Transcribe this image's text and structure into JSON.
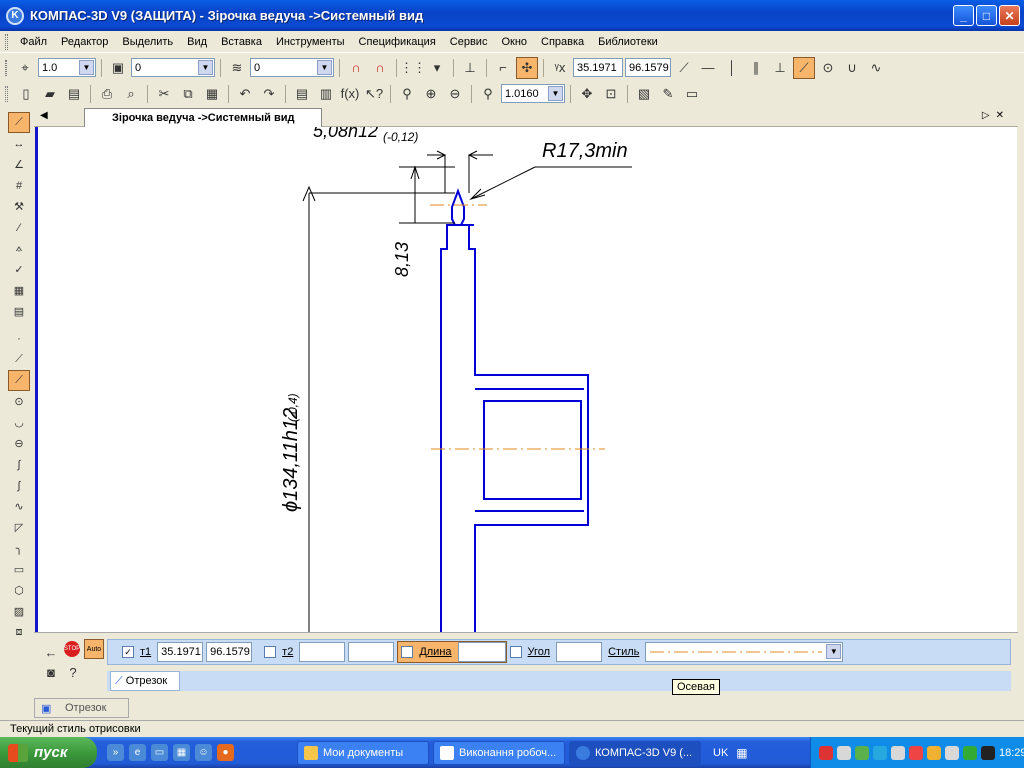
{
  "window": {
    "title": "КОМПАС-3D V9 (ЗАЩИТА) - Зірочка ведуча ->Системный вид"
  },
  "menu": [
    "Файл",
    "Редактор",
    "Выделить",
    "Вид",
    "Вставка",
    "Инструменты",
    "Спецификация",
    "Сервис",
    "Окно",
    "Справка",
    "Библиотеки"
  ],
  "toolbar1": {
    "step": "1.0",
    "layer1": "0",
    "layer2": "0",
    "coord_x": "35.1971",
    "coord_y": "96.1579"
  },
  "toolbar2": {
    "zoom": "1.0160"
  },
  "doc_tab": {
    "label": "Зірочка ведуча ->Системный вид"
  },
  "drawing": {
    "dim_top": "5,08h12",
    "dim_top_tol": "(-0,12)",
    "radius": "R17,3min",
    "dim_vert": "8,13",
    "diameter": "ϕ134,11h12",
    "diameter_tol": "(-0,4)",
    "colors": {
      "outline": "#0000d6",
      "axis": "#e08a1e",
      "dim": "#000000"
    }
  },
  "props": {
    "t1_label": "т1",
    "t1_x": "35.1971",
    "t1_y": "96.1579",
    "t2_label": "т2",
    "length_label": "Длина",
    "angle_label": "Угол",
    "style_label": "Стиль",
    "tab": "Отрезок"
  },
  "tooltip": "Осевая",
  "bottom_tab": "Отрезок",
  "status": "Текущий стиль отрисовки",
  "taskbar": {
    "start": "пуск",
    "tasks": [
      "Мои документы",
      "Виконання робоч...",
      "КОМПАС-3D V9 (..."
    ],
    "lang": "UK",
    "clock": "18:29"
  }
}
